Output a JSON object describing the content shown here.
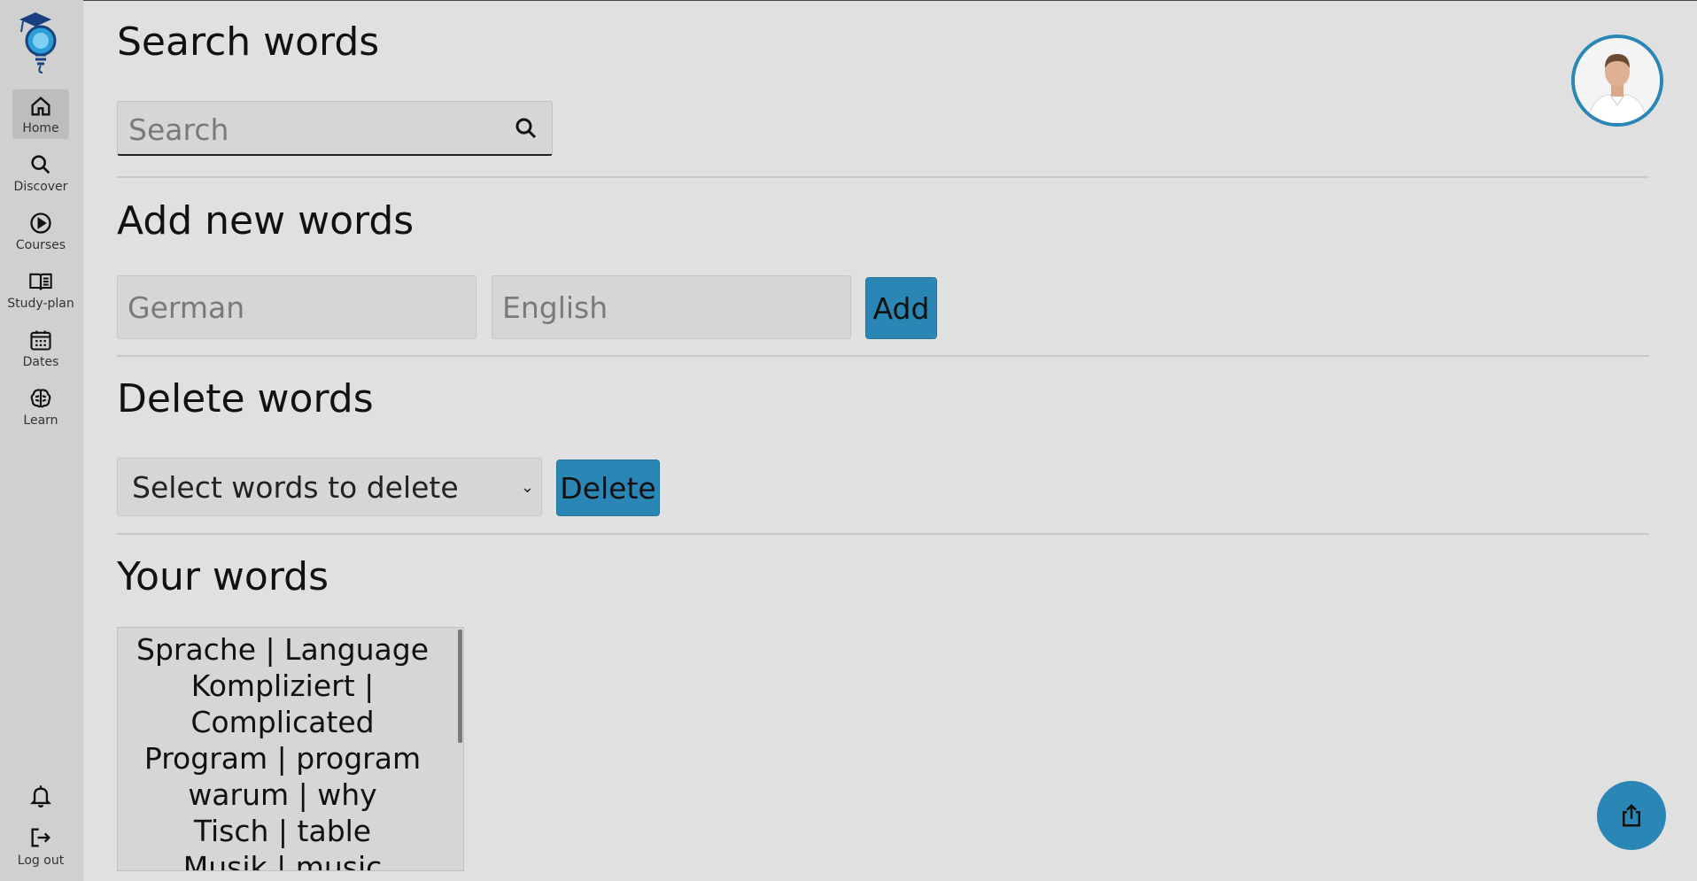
{
  "sidebar": {
    "items": [
      {
        "label": "Home",
        "icon": "home-icon"
      },
      {
        "label": "Discover",
        "icon": "search-icon"
      },
      {
        "label": "Courses",
        "icon": "play-circle-icon"
      },
      {
        "label": "Study-plan",
        "icon": "book-icon"
      },
      {
        "label": "Dates",
        "icon": "calendar-icon"
      },
      {
        "label": "Learn",
        "icon": "brain-icon"
      }
    ],
    "active": "Home",
    "logout_label": "Log out"
  },
  "search_section": {
    "title": "Search words",
    "placeholder": "Search"
  },
  "add_section": {
    "title": "Add new words",
    "german_placeholder": "German",
    "english_placeholder": "English",
    "add_label": "Add"
  },
  "delete_section": {
    "title": "Delete words",
    "select_value": "Select words to delete",
    "delete_label": "Delete"
  },
  "words_section": {
    "title": "Your words",
    "lines": [
      "Sprache | Language",
      "Kompliziert |",
      "Complicated",
      "Program | program",
      "warum | why",
      "Tisch | table",
      "Musik | music"
    ]
  },
  "colors": {
    "accent": "#2a87b5",
    "background": "#e0e0e0",
    "sidebar": "#d0d0d0"
  }
}
